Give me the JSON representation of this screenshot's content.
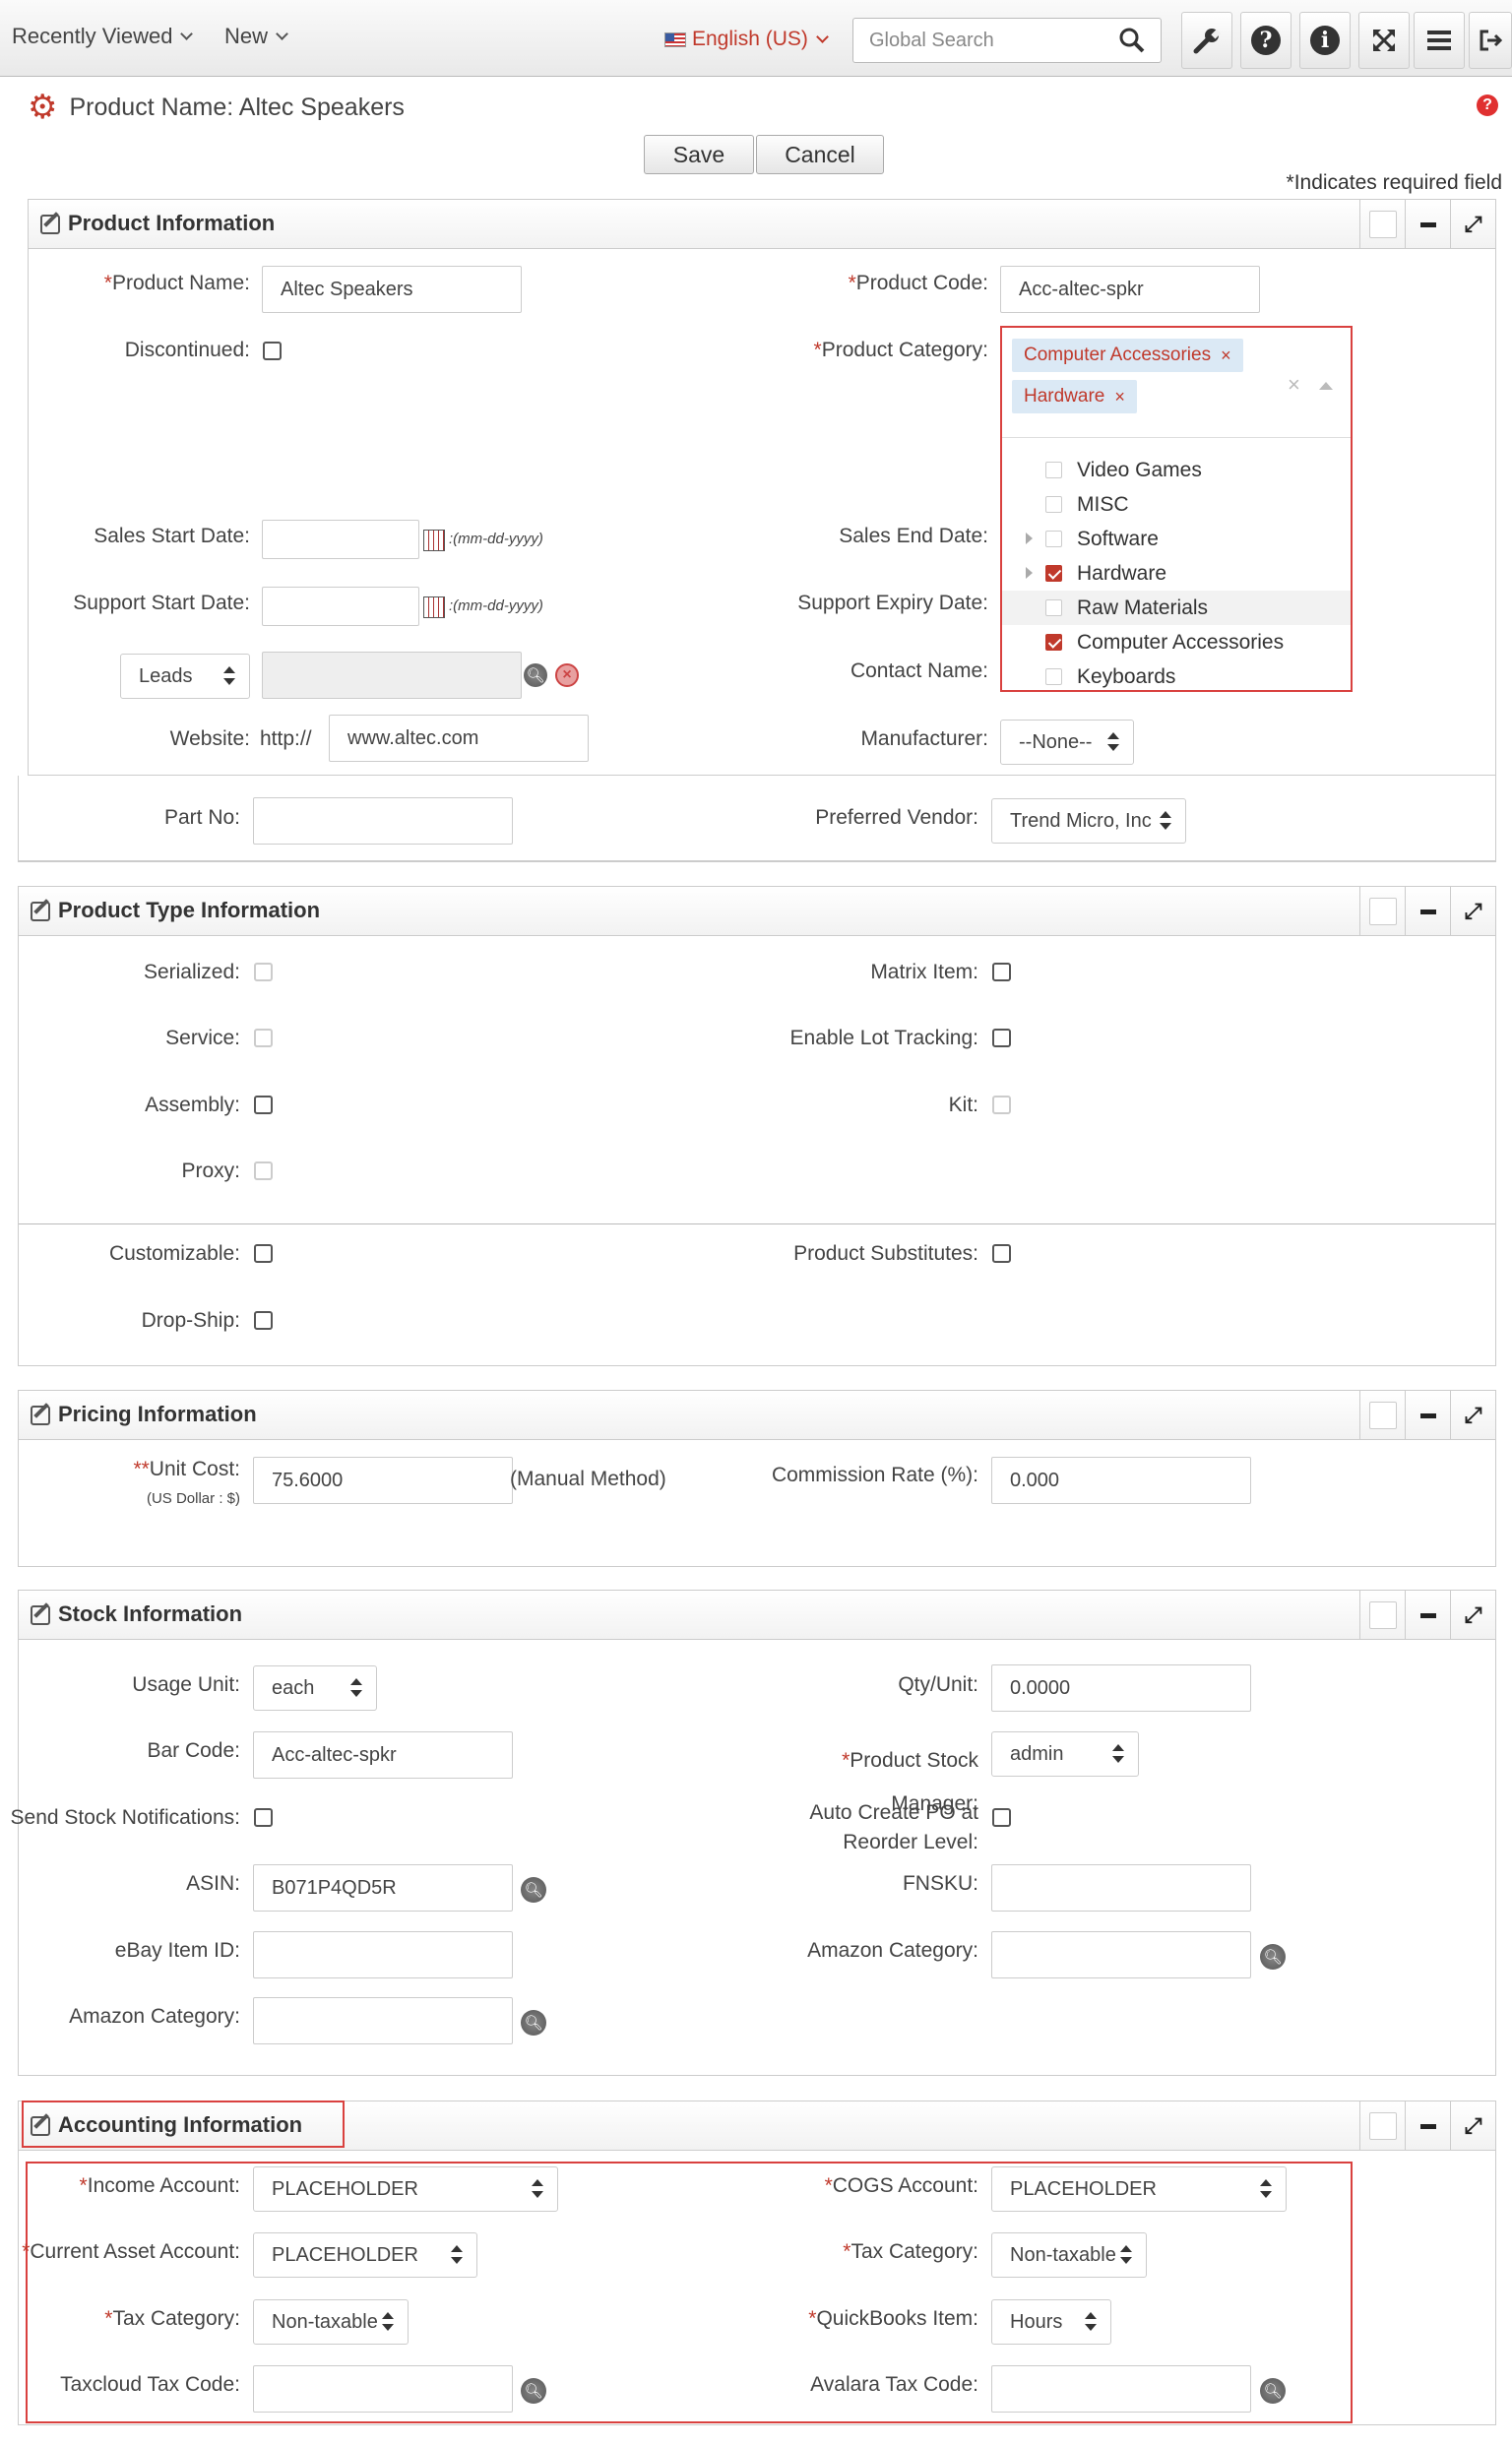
{
  "topbar": {
    "recently_viewed": "Recently Viewed",
    "new": "New",
    "language": "English (US)",
    "search_placeholder": "Global Search"
  },
  "page": {
    "title": "Product Name: Altec Speakers",
    "save": "Save",
    "cancel": "Cancel",
    "required_note": "*Indicates required field"
  },
  "product_info": {
    "title": "Product Information",
    "product_name_label": "Product Name:",
    "product_name": "Altec Speakers",
    "product_code_label": "Product Code:",
    "product_code": "Acc-altec-spkr",
    "discontinued_label": "Discontinued:",
    "product_category_label": "Product Category:",
    "selected_categories": [
      "Computer Accessories",
      "Hardware"
    ],
    "category_options": [
      {
        "name": "Video Games",
        "checked": false,
        "expandable": false
      },
      {
        "name": "MISC",
        "checked": false,
        "expandable": false
      },
      {
        "name": "Software",
        "checked": false,
        "expandable": true
      },
      {
        "name": "Hardware",
        "checked": true,
        "expandable": true
      },
      {
        "name": "Raw Materials",
        "checked": false,
        "expandable": false
      },
      {
        "name": "Computer Accessories",
        "checked": true,
        "expandable": false
      },
      {
        "name": "Keyboards",
        "checked": false,
        "expandable": false
      }
    ],
    "sales_start_label": "Sales Start Date:",
    "sales_end_label": "Sales End Date:",
    "support_start_label": "Support Start Date:",
    "support_expiry_label": "Support Expiry Date:",
    "date_format": ":(mm-dd-yyyy)",
    "leads_select": "Leads",
    "contact_name_label": "Contact Name:",
    "website_label": "Website:",
    "website_prefix": "http://",
    "website": "www.altec.com",
    "manufacturer_label": "Manufacturer:",
    "manufacturer": "--None--",
    "part_no_label": "Part No:",
    "preferred_vendor_label": "Preferred Vendor:",
    "preferred_vendor": "Trend Micro, Inc"
  },
  "product_type": {
    "title": "Product Type Information",
    "serialized": "Serialized:",
    "matrix_item": "Matrix Item:",
    "service": "Service:",
    "lot_tracking": "Enable Lot Tracking:",
    "assembly": "Assembly:",
    "kit": "Kit:",
    "proxy": "Proxy:",
    "customizable": "Customizable:",
    "substitutes": "Product Substitutes:",
    "dropship": "Drop-Ship:"
  },
  "pricing": {
    "title": "Pricing Information",
    "unit_cost_label": "Unit Cost:",
    "currency_hint": "(US Dollar : $)",
    "unit_cost": "75.6000",
    "method": "(Manual Method)",
    "commission_label": "Commission Rate (%):",
    "commission": "0.000"
  },
  "stock": {
    "title": "Stock Information",
    "usage_unit_label": "Usage Unit:",
    "usage_unit": "each",
    "qty_unit_label": "Qty/Unit:",
    "qty_unit": "0.0000",
    "bar_code_label": "Bar Code:",
    "bar_code": "Acc-altec-spkr",
    "stock_manager_label_1": "Product Stock",
    "stock_manager_label_2": "Manager:",
    "stock_manager": "admin",
    "send_notif_label": "Send Stock Notifications:",
    "auto_po_label_1": "Auto Create PO at",
    "auto_po_label_2": "Reorder Level:",
    "asin_label": "ASIN:",
    "asin": "B071P4QD5R",
    "fnsku_label": "FNSKU:",
    "ebay_label": "eBay Item ID:",
    "amazon_cat_label": "Amazon Category:"
  },
  "accounting": {
    "title": "Accounting Information",
    "income_label": "Income Account:",
    "income": "PLACEHOLDER",
    "cogs_label": "COGS Account:",
    "cogs": "PLACEHOLDER",
    "asset_label": "Current Asset Account:",
    "asset": "PLACEHOLDER",
    "tax_cat_label": "Tax Category:",
    "tax_cat": "Non-taxable",
    "qb_label": "QuickBooks Item:",
    "qb": "Hours",
    "taxcloud_label": "Taxcloud Tax Code:",
    "avalara_label": "Avalara Tax Code:"
  },
  "colors": {
    "accent": "#c0392b",
    "highlight_box": "#d9413f"
  }
}
